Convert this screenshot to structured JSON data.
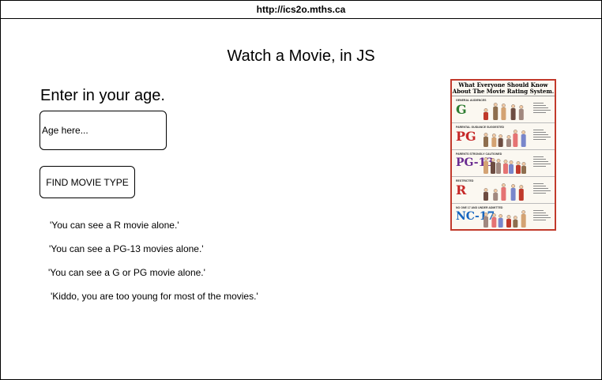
{
  "browser": {
    "url": "http://ics2o.mths.ca"
  },
  "page": {
    "title": "Watch a Movie, in JS",
    "prompt": "Enter in your age.",
    "age_input": {
      "placeholder": "Age here...",
      "value": ""
    },
    "find_button_label": "FIND MOVIE TYPE",
    "results": [
      "'You can see a R movie alone.'",
      "'You can see a PG-13 movies alone.'",
      "'You can see a G or PG movie alone.'",
      "'Kiddo, you are too young for most of the movies.'"
    ]
  },
  "poster": {
    "heading": "What Everyone Should Know About The Movie Rating System.",
    "ratings": [
      {
        "code": "G",
        "caption": "GENERAL AUDIENCES",
        "color": "#2e7d32"
      },
      {
        "code": "PG",
        "caption": "PARENTAL GUIDANCE SUGGESTED",
        "color": "#c62828"
      },
      {
        "code": "PG-13",
        "caption": "PARENTS STRONGLY CAUTIONED",
        "color": "#6a2c91"
      },
      {
        "code": "R",
        "caption": "RESTRICTED",
        "color": "#c62828"
      },
      {
        "code": "NC-17",
        "caption": "NO ONE 17 AND UNDER ADMITTED",
        "color": "#1565c0"
      }
    ],
    "border_color": "#c23a2b"
  }
}
